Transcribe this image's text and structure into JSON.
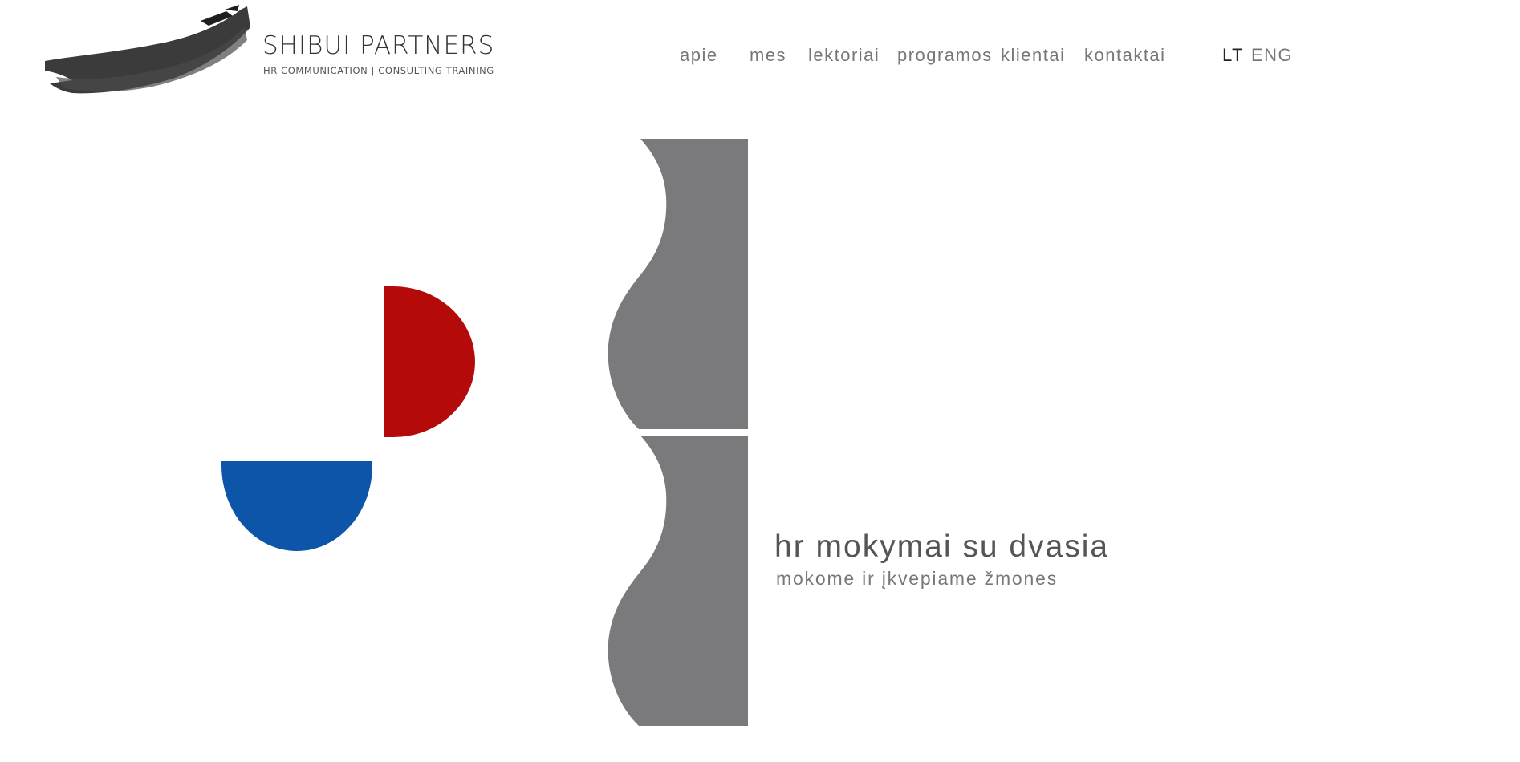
{
  "brand": {
    "name": "SHIBUI PARTNERS",
    "tagline": "HR COMMUNICATION | CONSULTING TRAINING"
  },
  "nav": {
    "items": [
      {
        "label": "apie"
      },
      {
        "label": "mes"
      },
      {
        "label": "lektoriai"
      },
      {
        "label": "programos"
      },
      {
        "label": "klientai"
      },
      {
        "label": "kontaktai"
      }
    ]
  },
  "languages": {
    "items": [
      {
        "label": "LT",
        "active": true
      },
      {
        "label": "ENG",
        "active": false
      }
    ]
  },
  "hero": {
    "headline": "hr mokymai su dvasia",
    "subline": "mokome ir įkvepiame žmones"
  },
  "colors": {
    "red_shape": "#b50a0a",
    "blue_shape": "#0c55a8",
    "grey_shape": "#7a7a7c",
    "brush": "#2a2a2a"
  }
}
